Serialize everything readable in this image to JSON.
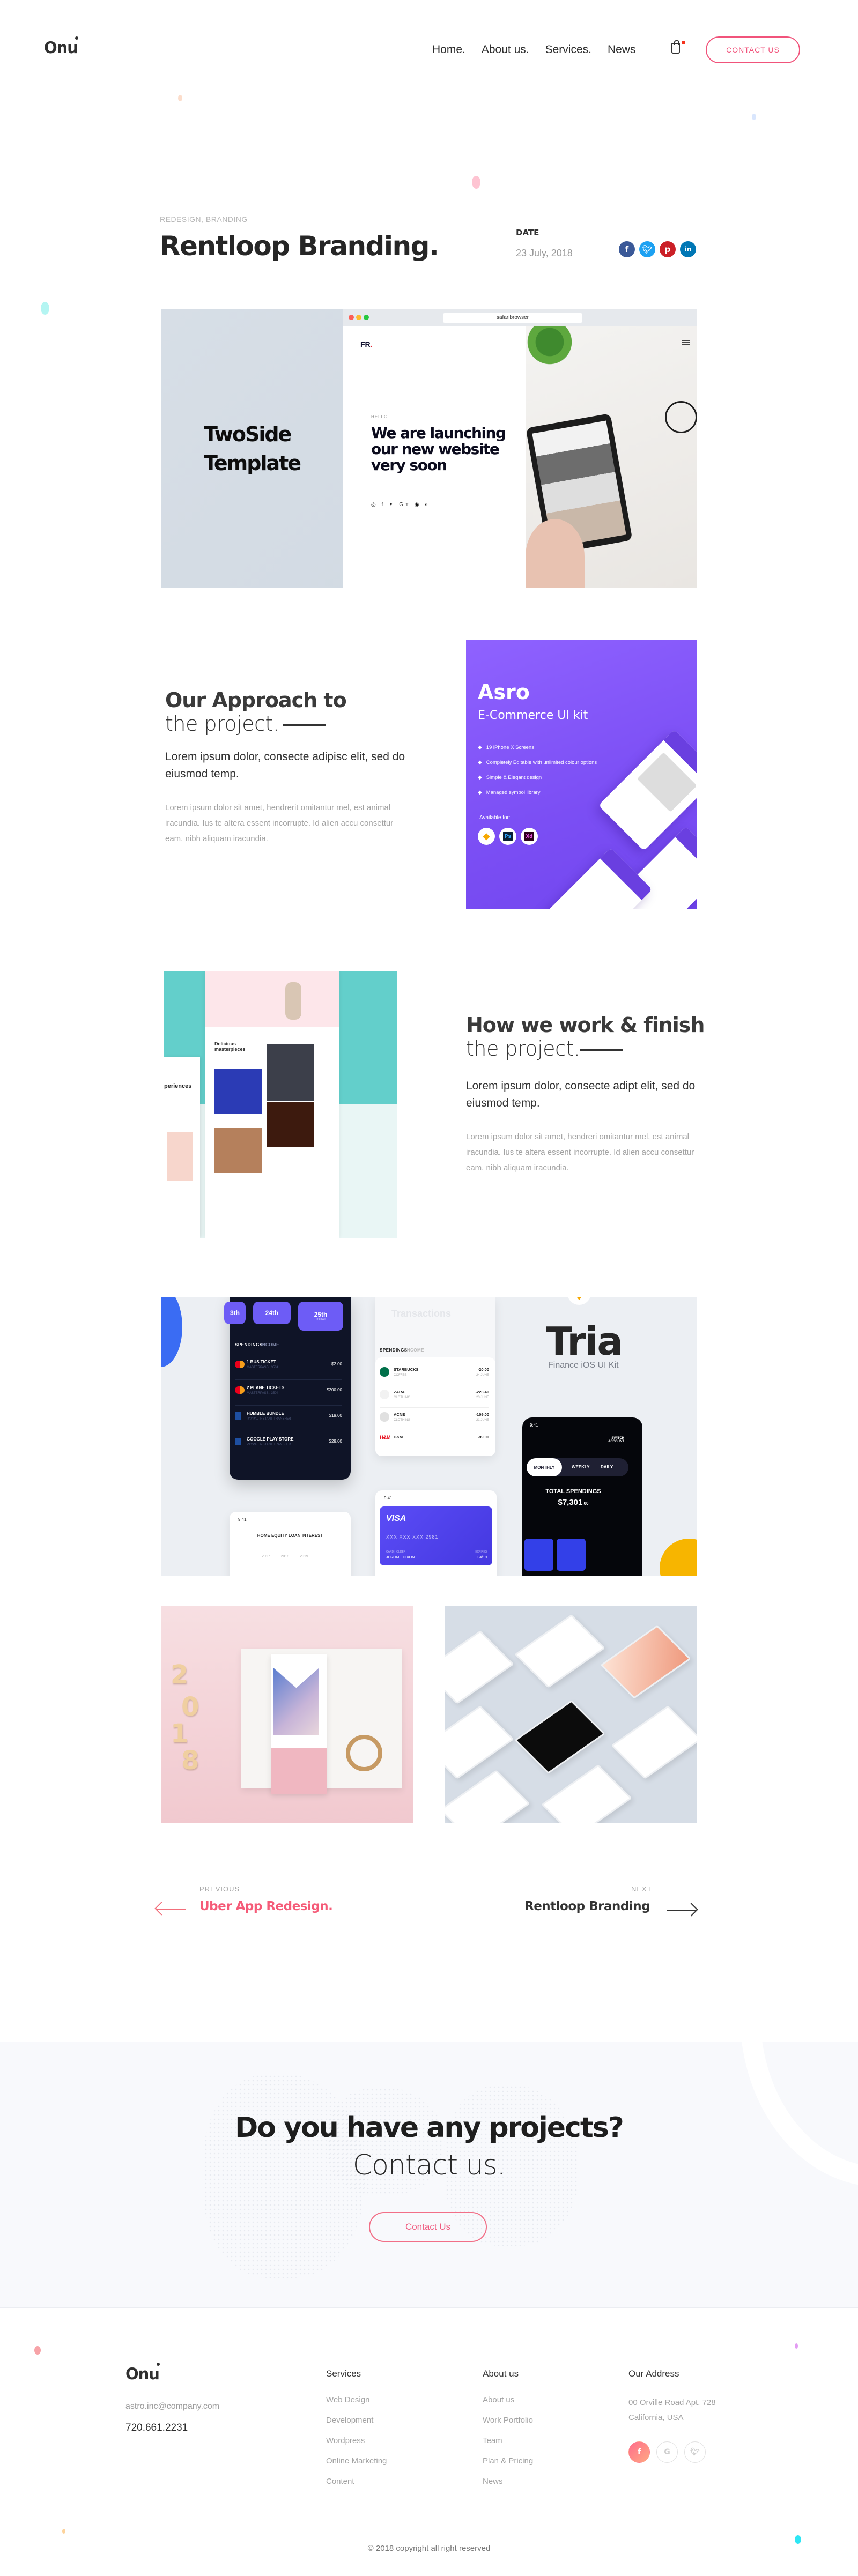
{
  "header": {
    "logo": "Onu",
    "nav": [
      "Home.",
      "About us.",
      "Services.",
      "News"
    ],
    "cart_icon": "shopping-bag-icon",
    "contact_label": "CONTACT US",
    "accent_color": "#f1537b"
  },
  "project": {
    "tags": "REDESIGN, BRANDING",
    "title": "Rentloop Branding.",
    "date_label": "DATE",
    "date_value": "23 July, 2018",
    "share": [
      {
        "name": "facebook",
        "glyph": "f",
        "color": "#3b5998"
      },
      {
        "name": "twitter",
        "glyph": "t",
        "color": "#1da1f2"
      },
      {
        "name": "pinterest",
        "glyph": "p",
        "color": "#cb2027"
      },
      {
        "name": "linkedin",
        "glyph": "in",
        "color": "#0077b5"
      }
    ]
  },
  "hero_mockup": {
    "side_title_line1": "TwoSide",
    "side_title_line2": "Template",
    "browser_url": "safaribrowser",
    "site_logo": "FR",
    "site_logo_dot": ".",
    "hello": "HELLO",
    "headline": "We are launching our new website very soon",
    "social_glyphs": "◎ f ✦ G+ ◉ ◐"
  },
  "approach": {
    "heading_bold": "Our Approach to",
    "heading_light": "the project.",
    "lead": "Lorem ipsum dolor, consecte adipisc elit, sed do eiusmod temp.",
    "body": "Lorem ipsum dolor sit amet, hendrerit omitantur mel, est animal iracundia. Ius te altera essent incorrupte. Id alien accu consettur eam, nibh aliquam iracundia."
  },
  "asro": {
    "title": "Asro",
    "subtitle": "E-Commerce UI kit",
    "features": [
      "19 iPhone X Screens",
      "Completely Editable with unlimited colour options",
      "Simple & Elegant design",
      "Managed symbol library"
    ],
    "available_label": "Available for:",
    "tools": [
      "Sketch",
      "Ps",
      "Xd"
    ]
  },
  "how_we_work": {
    "heading_bold": "How we work & finish",
    "heading_light": "the project.",
    "lead": "Lorem ipsum dolor, consecte adipt elit, sed do eiusmod temp.",
    "body": "Lorem ipsum dolor sit amet, hendreri omitantur mel, est animal iracundia. Ius te altera essent incorrupte. Id alien accu consettur eam, nibh aliquam iracundia.",
    "mockup_heading": "periences",
    "mockup_sub": "Delicious masterpieces"
  },
  "tria": {
    "title": "Tria",
    "subtitle": "Finance iOS UI Kit",
    "dates": [
      "3th",
      "24th",
      "25th"
    ],
    "today_label": "TODAY",
    "tabs": [
      "SPENDINGS",
      "INCOME"
    ],
    "dark_transactions": [
      {
        "name": "1 BUS TICKET",
        "sub": "MASTERPASS.. 3504",
        "amount": "$2.00"
      },
      {
        "name": "2 PLANE TICKETS",
        "sub": "MASTERPASS.. 3504",
        "amount": "$200.00"
      },
      {
        "name": "HUMBLE BUNDLE",
        "sub": "PAYPAL INSTANT TRANSFER",
        "amount": "$19.00"
      },
      {
        "name": "GOOGLE PLAY STORE",
        "sub": "PAYPAL INSTANT TRANSFER",
        "amount": "$28.00"
      }
    ],
    "transactions_title": "Transactions",
    "light_transactions": [
      {
        "name": "STARBUCKS",
        "sub": "COFFEE",
        "amount": "-20.00",
        "date": "24 JUNE"
      },
      {
        "name": "ZARA",
        "sub": "CLOTHING",
        "amount": "-223.40",
        "date": "23 JUNE"
      },
      {
        "name": "ACNE",
        "sub": "CLOTHING",
        "amount": "-109.00",
        "date": "21 JUNE"
      },
      {
        "name": "H&M",
        "sub": "CLOTHING",
        "amount": "-99.00",
        "date": "21 JUNE"
      }
    ],
    "switch_account": "SWITCH ACCOUNT",
    "periods": [
      "MONTHLY",
      "WEEKLY",
      "DAILY"
    ],
    "total_label": "TOTAL SPENDINGS",
    "total_value": "$7,301",
    "total_cents": ".00",
    "status_time": "9:41",
    "loan_title": "HOME EQUITY LOAN INTEREST",
    "loan_years": [
      "2017",
      "2018",
      "2019"
    ],
    "card_brand": "VISA",
    "card_number": "XXX  XXX  XXX  2981",
    "card_holder_label": "CARD HOLDER",
    "card_holder": "JEROME DIXON",
    "expires_label": "EXPIRES",
    "expires": "04/19"
  },
  "gallery": {
    "year_digits": [
      "2",
      "0",
      "1",
      "8"
    ]
  },
  "pager": {
    "prev_label": "PREVIOUS",
    "prev_title": "Uber App Redesign.",
    "next_label": "NEXT",
    "next_title": "Rentloop Branding"
  },
  "cta": {
    "heading": "Do you have any projects?",
    "subheading": "Contact us.",
    "button": "Contact Us"
  },
  "footer": {
    "logo": "Onu",
    "email": "astro.inc@company.com",
    "phone": "720.661.2231",
    "services_title": "Services",
    "services": [
      "Web Design",
      "Development",
      "Wordpress",
      "Online Marketing",
      "Content"
    ],
    "about_title": "About us",
    "about": [
      "About us",
      "Work Portfolio",
      "Team",
      "Plan & Pricing",
      "News"
    ],
    "address_title": "Our Address",
    "address_line1": "00 Orville Road Apt. 728",
    "address_line2": "California, USA",
    "socials": [
      {
        "name": "facebook",
        "glyph": "f"
      },
      {
        "name": "google",
        "glyph": "G"
      },
      {
        "name": "twitter",
        "glyph": "t"
      }
    ],
    "copyright": "© 2018 copyright all right reserved"
  }
}
